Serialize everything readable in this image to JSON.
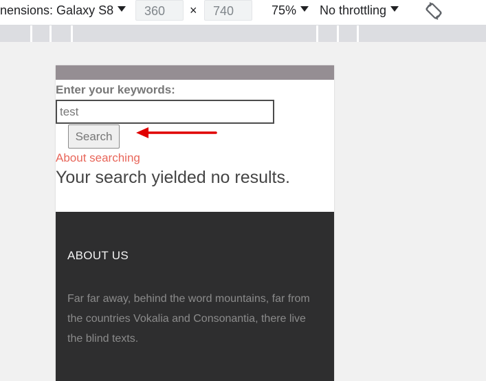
{
  "devtools": {
    "dimensions_label": "nensions: Galaxy S8",
    "width_value": "360",
    "times_symbol": "×",
    "height_value": "740",
    "zoom_label": "75%",
    "throttle_label": "No throttling",
    "rotate_icon": "rotate-icon"
  },
  "page": {
    "keywords_label": "Enter your keywords:",
    "search_value": "test",
    "search_button_label": "Search",
    "about_link_text": "About searching",
    "no_results_text": "Your search yielded no results."
  },
  "footer": {
    "heading": "ABOUT US",
    "body_text": "Far far away, behind the word mountains, far from the countries Vokalia and Consonantia, there live the blind texts."
  },
  "colors": {
    "link": "#e8665a",
    "footer_bg": "#2e2e2f",
    "top_band": "#958e93",
    "annotation_arrow": "#e00000"
  }
}
